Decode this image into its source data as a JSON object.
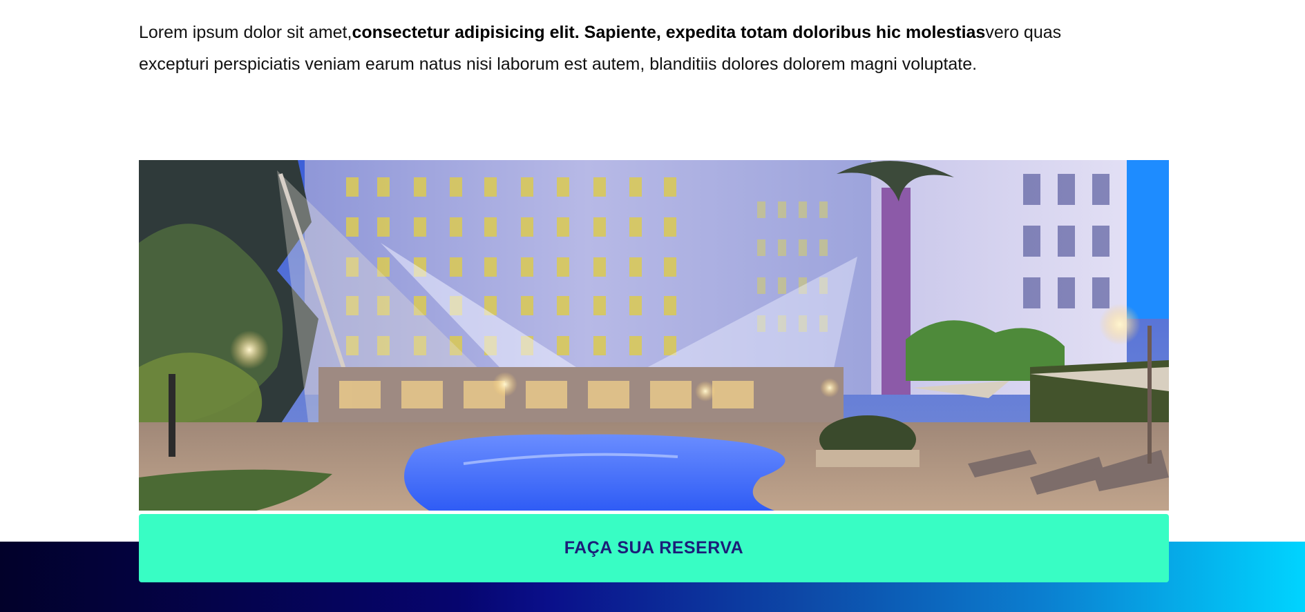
{
  "intro": {
    "text_before": "Lorem ipsum dolor sit amet,",
    "text_bold": "consectetur adipisicing elit. Sapiente, expedita totam doloribus hic molestias",
    "text_after": "vero quas excepturi perspiciatis veniam earum natus nisi laborum est autem, blanditiis dolores dolorem magni voluptate."
  },
  "hero": {
    "icon": "hotel-pool-photo"
  },
  "cta": {
    "label": "FAÇA SUA RESERVA"
  },
  "colors": {
    "cta_background": "#38fdc4",
    "cta_text": "#1c1d78",
    "footer_gradient_start": "#02012a",
    "footer_gradient_end": "#00d4ff"
  }
}
